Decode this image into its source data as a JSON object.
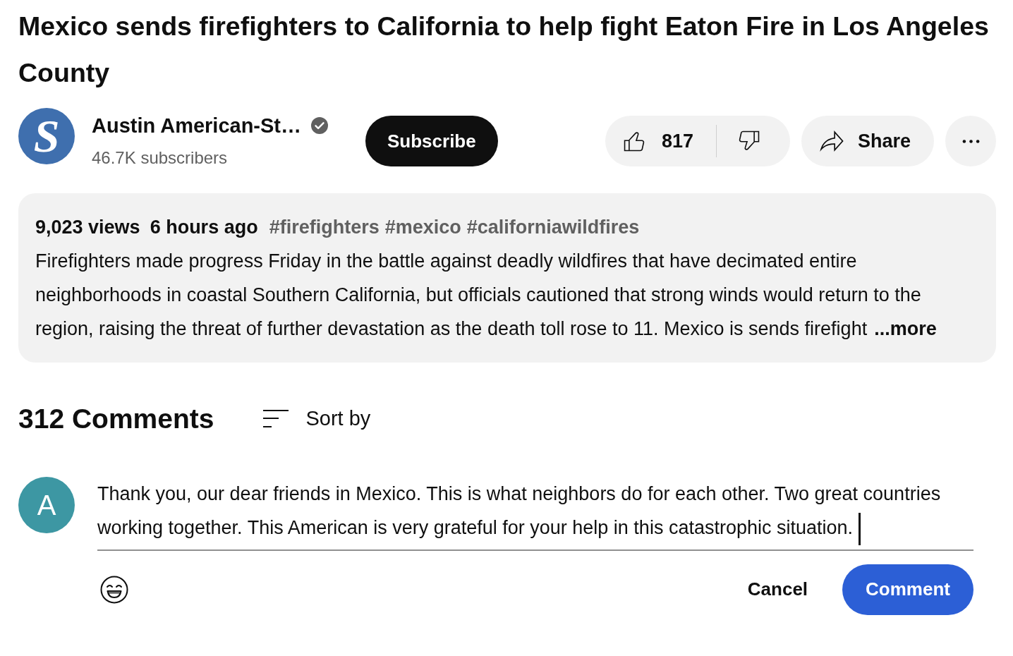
{
  "video": {
    "title": "Mexico sends firefighters to California to help fight Eaton Fire in Los Angeles County"
  },
  "channel": {
    "avatar_letter": "S",
    "name": "Austin American-St…",
    "verified": true,
    "subscribers": "46.7K subscribers",
    "subscribe_label": "Subscribe"
  },
  "actions": {
    "likes": "817",
    "share_label": "Share"
  },
  "description": {
    "views": "9,023 views",
    "age": "6 hours ago",
    "hashtags": [
      "#firefighters",
      "#mexico",
      "#californiawildfires"
    ],
    "text": "Firefighters made progress Friday in the battle against deadly wildfires that have decimated entire neighborhoods in coastal Southern California, but officials cautioned that strong winds would return to the region, raising the threat of further devastation as the death toll rose to 11. Mexico is sends firefight",
    "more_label": "...more"
  },
  "comments": {
    "count_label": "312 Comments",
    "sort_label": "Sort by"
  },
  "composer": {
    "avatar_letter": "A",
    "value": "Thank you, our dear friends in Mexico. This is what neighbors do for each other. Two great countries working together. This American is very grateful for your help in this catastrophic situation.",
    "focused": true,
    "cancel_label": "Cancel",
    "submit_label": "Comment"
  }
}
